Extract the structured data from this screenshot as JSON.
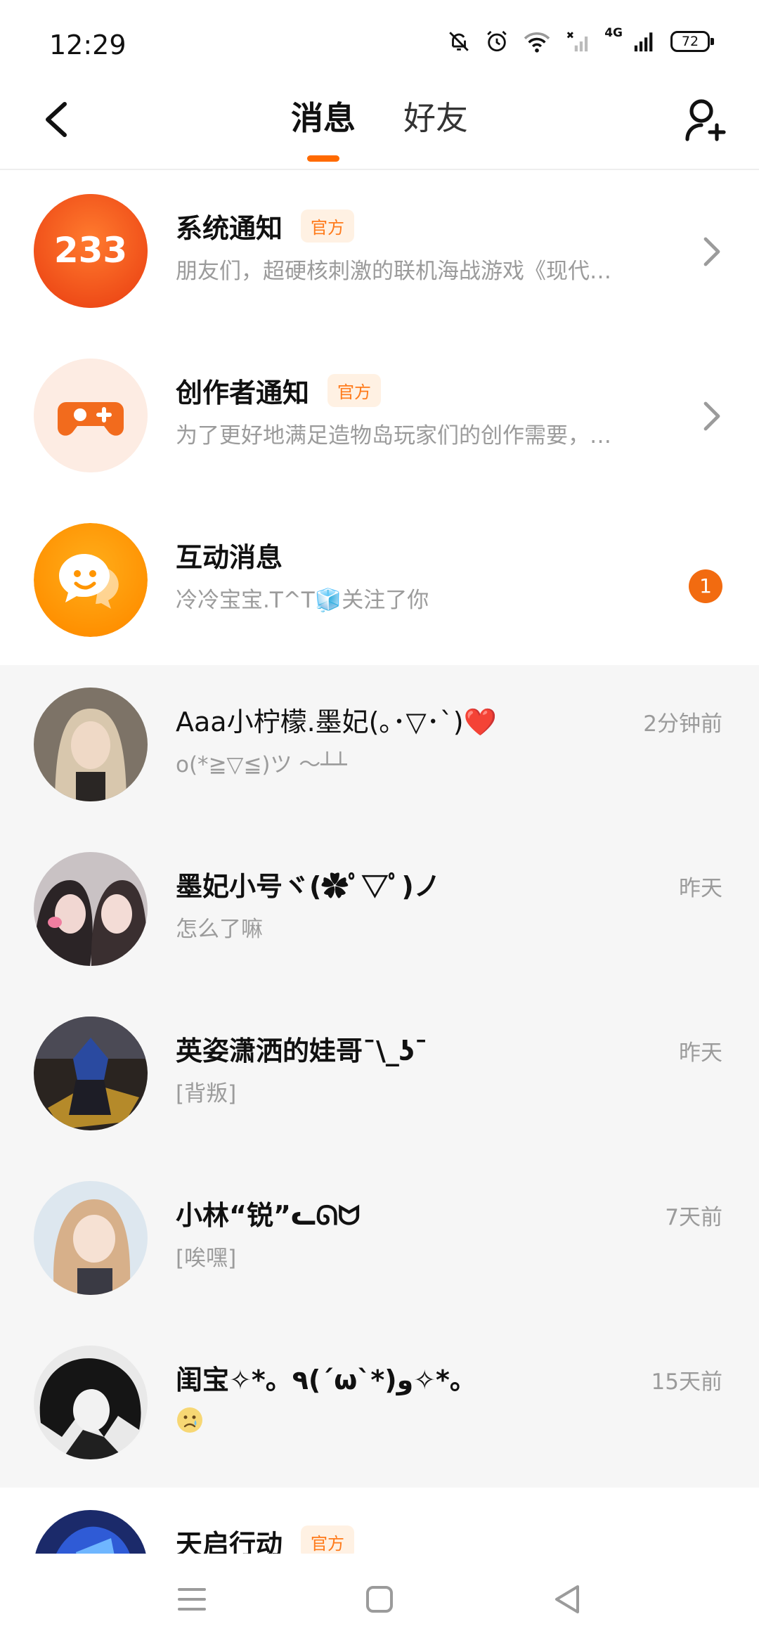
{
  "status_bar": {
    "time": "12:29",
    "network": "4G",
    "battery": "72"
  },
  "header": {
    "tabs": [
      {
        "label": "消息",
        "active": true
      },
      {
        "label": "好友",
        "active": false
      }
    ],
    "icons": {
      "back": "chevron-left-icon",
      "add_friend": "add-user-icon"
    }
  },
  "colors": {
    "accent": "#ff6a00",
    "badge_bg": "#fff1e3",
    "unread": "#f26b10"
  },
  "conversations": [
    {
      "name": "系统通知",
      "badge": "官方",
      "avatar_text": "233",
      "preview": "朋友们，超硬核刺激的联机海战游戏《现代…",
      "time": "",
      "unread": "",
      "chevron": true
    },
    {
      "name": "创作者通知",
      "badge": "官方",
      "avatar_icon": "gamepad-icon",
      "preview": "为了更好地满足造物岛玩家们的创作需要，…",
      "time": "",
      "unread": "",
      "chevron": true
    },
    {
      "name": "互动消息",
      "badge": "",
      "avatar_icon": "chat-bubble-icon",
      "preview": "冷冷宝宝.T^T🧊关注了你",
      "time": "",
      "unread": "1",
      "chevron": false
    },
    {
      "name": "Aaa小柠檬.墨妃(｡･▽･`)❤️",
      "badge": "",
      "preview": "o(*≧▽≦)ツ ～┴┴",
      "time": "2分钟前",
      "unread": "",
      "chevron": false
    },
    {
      "name": "墨妃小号ヾ(✿ﾟ▽ﾟ)ノ",
      "badge": "",
      "preview": "怎么了嘛",
      "time": "昨天",
      "unread": "",
      "chevron": false
    },
    {
      "name": "英姿潇洒的娃哥¯\\_ʖ¯",
      "badge": "",
      "preview": "[背叛]",
      "time": "昨天",
      "unread": "",
      "chevron": false
    },
    {
      "name": "小林“锐”ᓚᘏᗢ",
      "badge": "",
      "preview": "[唉嘿]",
      "time": "7天前",
      "unread": "",
      "chevron": false
    },
    {
      "name": "闺宝✧*。٩(ˊωˋ*)و✧*。",
      "badge": "",
      "preview": "",
      "preview_emoji": "crying-face-icon",
      "time": "15天前",
      "unread": "",
      "chevron": false
    },
    {
      "name": "天启行动",
      "badge": "官方",
      "preview": "",
      "time": "",
      "unread": "",
      "chevron": false
    }
  ],
  "nav_bar": {
    "icons": [
      "menu-icon",
      "home-square-icon",
      "back-triangle-icon"
    ]
  }
}
